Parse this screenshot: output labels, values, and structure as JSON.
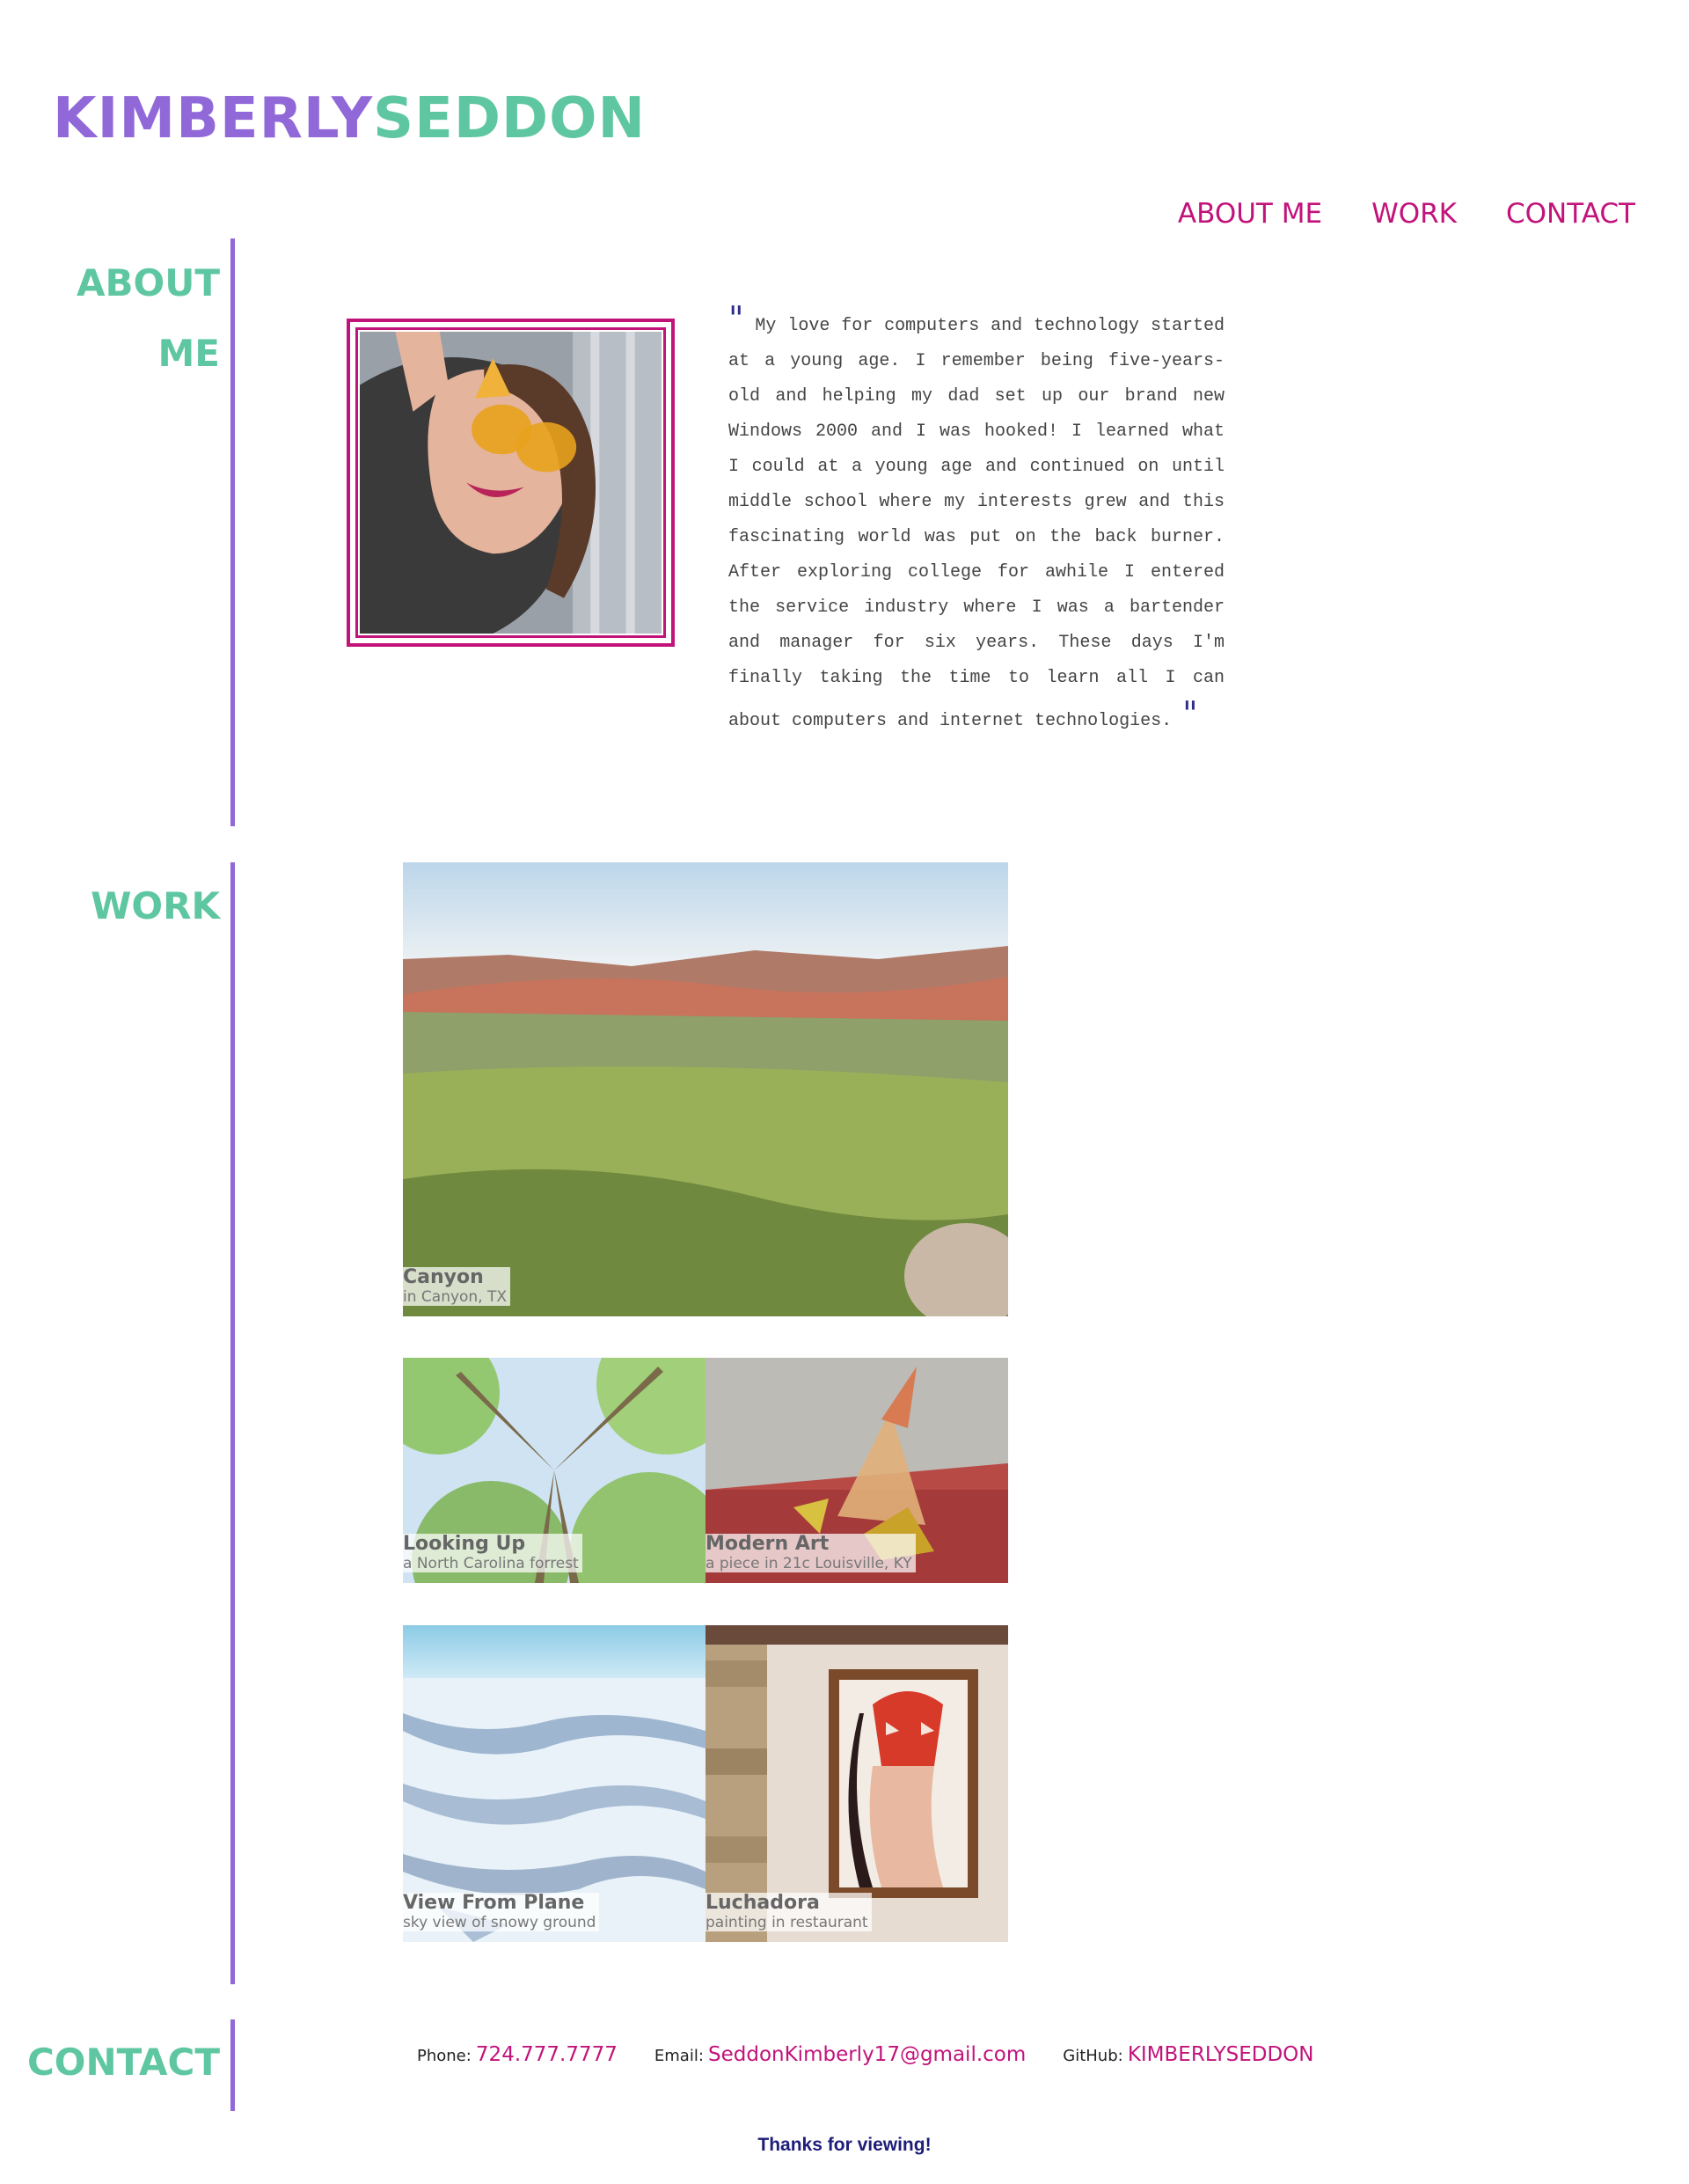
{
  "header": {
    "logo_first": "KIMBERLY",
    "logo_last": "SEDDON"
  },
  "nav": [
    {
      "label": "ABOUT ME"
    },
    {
      "label": "WORK"
    },
    {
      "label": "CONTACT"
    }
  ],
  "about": {
    "label_line1": "ABOUT",
    "label_line2": "ME",
    "open_quote": "\"",
    "close_quote": "\"",
    "text": "My love for computers and technology started at a young age. I remember being five-years-old and helping my dad set up our brand new Windows 2000 and I was hooked! I learned what I could at a young age and continued on until middle school where my interests grew and this fascinating world was put on the back burner. After exploring college for awhile I entered the service industry where I was a bartender and manager for six years. These days I'm finally taking the time to learn all I can about computers and internet technologies."
  },
  "work": {
    "label": "WORK",
    "items": [
      {
        "title": "Canyon",
        "subtitle": "in Canyon, TX"
      },
      {
        "title": "Looking Up",
        "subtitle": "a North Carolina forrest"
      },
      {
        "title": "Modern Art",
        "subtitle": "a piece in 21c Louisville, KY"
      },
      {
        "title": "View From Plane",
        "subtitle": "sky view of snowy ground"
      },
      {
        "title": "Luchadora",
        "subtitle": "painting in restaurant"
      }
    ]
  },
  "contact": {
    "label": "CONTACT",
    "phone_label": "Phone:",
    "phone": "724.777.7777",
    "email_label": "Email:",
    "email": "SeddonKimberly17@gmail.com",
    "github_label": "GitHub:",
    "github": "KIMBERLYSEDDON"
  },
  "footer": {
    "thanks": "Thanks for viewing!"
  },
  "colors": {
    "teal": "#5ec7a2",
    "purple": "#9168d8",
    "magenta": "#c2137b",
    "navy": "#1d1d7a"
  }
}
